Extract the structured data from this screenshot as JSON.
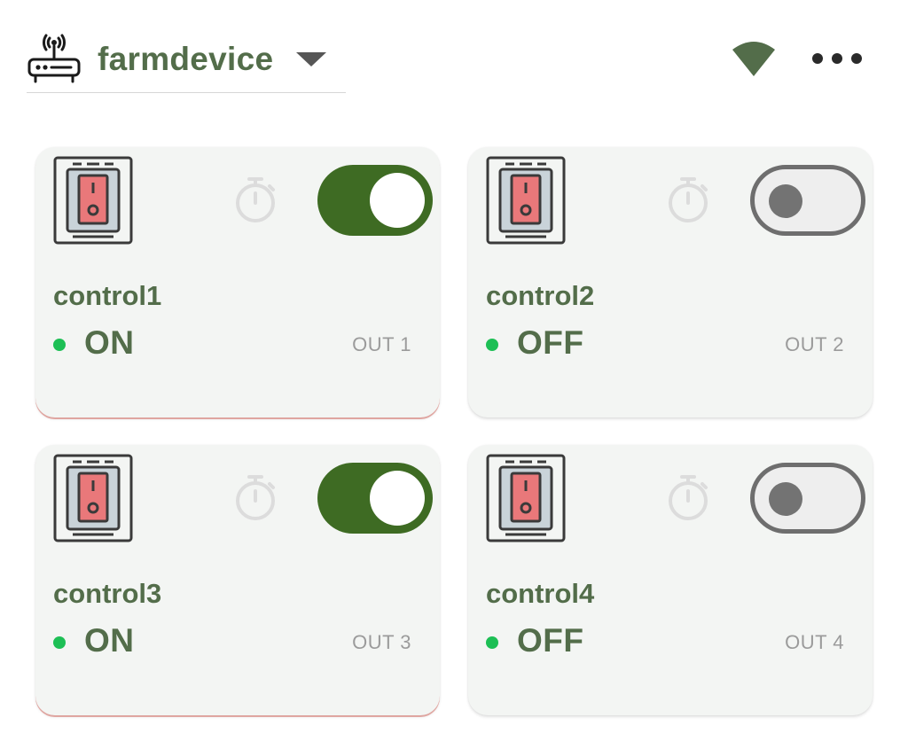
{
  "header": {
    "device_name": "farmdevice",
    "icons": {
      "device": "router-icon",
      "dropdown": "caret-down-icon",
      "signal": "wifi-icon",
      "menu": "more-horizontal-icon"
    }
  },
  "colors": {
    "accent": "#3e6b23",
    "title_text": "#536d4a",
    "status_dot": "#1dbf55",
    "card_background": "#f3f5f3",
    "switch_red": "#e9787a"
  },
  "controls": [
    {
      "name": "control1",
      "status": "ON",
      "output": "OUT 1",
      "enabled": true
    },
    {
      "name": "control2",
      "status": "OFF",
      "output": "OUT 2",
      "enabled": false
    },
    {
      "name": "control3",
      "status": "ON",
      "output": "OUT 3",
      "enabled": true
    },
    {
      "name": "control4",
      "status": "OFF",
      "output": "OUT 4",
      "enabled": false
    }
  ],
  "card_icons": {
    "switch": "wall-switch-icon",
    "timer": "stopwatch-icon"
  }
}
